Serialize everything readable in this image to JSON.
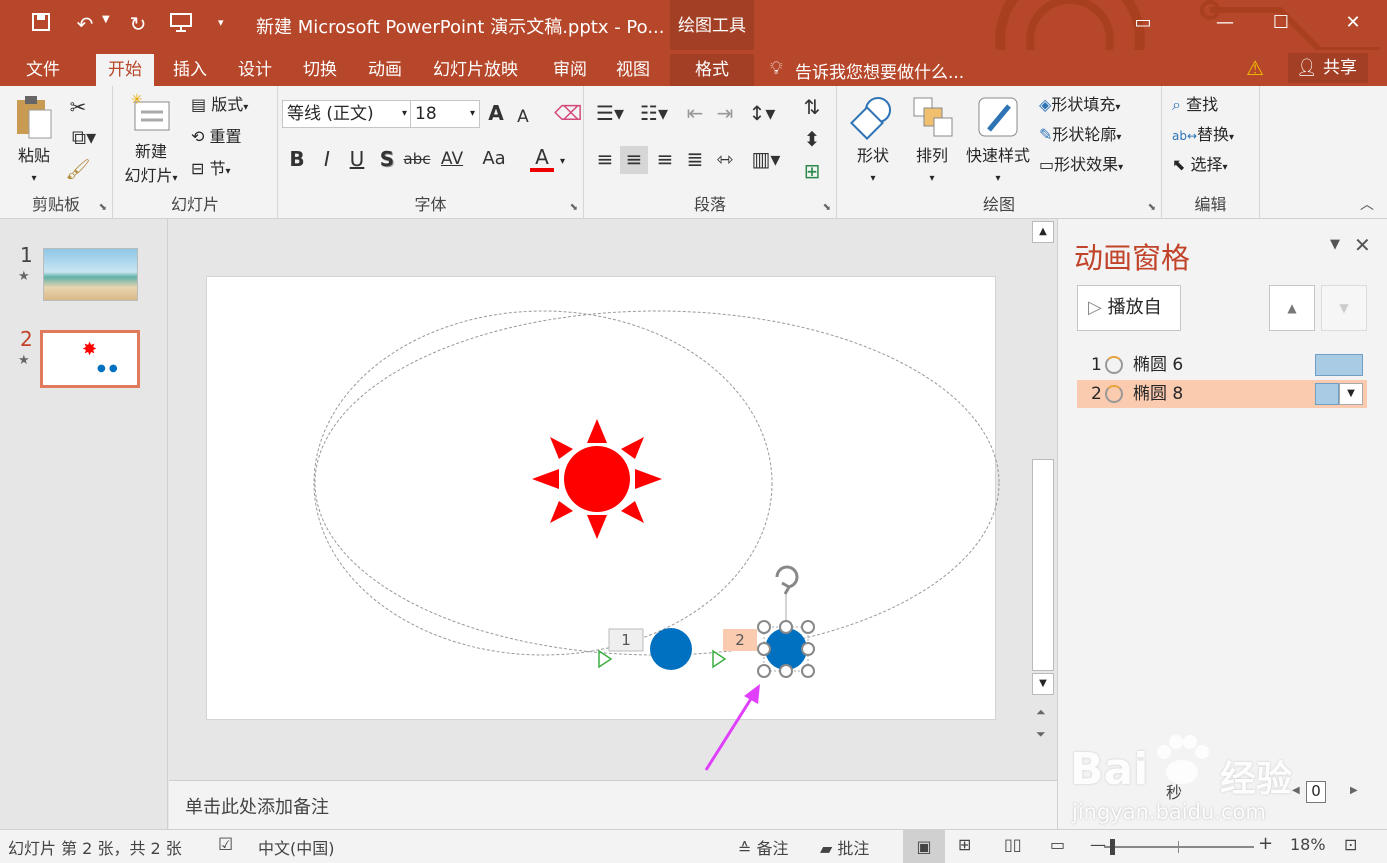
{
  "window": {
    "title": "新建 Microsoft PowerPoint 演示文稿.pptx - Po...",
    "context_tools": "绘图工具"
  },
  "tabs": [
    "文件",
    "开始",
    "插入",
    "设计",
    "切换",
    "动画",
    "幻灯片放映",
    "审阅",
    "视图",
    "格式"
  ],
  "tell_me": "告诉我您想要做什么...",
  "share": "共享",
  "ribbon": {
    "clipboard": {
      "paste": "粘贴",
      "label": "剪贴板"
    },
    "slides": {
      "new_slide_1": "新建",
      "new_slide_2": "幻灯片",
      "layout": "版式",
      "reset": "重置",
      "section": "节",
      "label": "幻灯片"
    },
    "font": {
      "font_name": "等线 (正文)",
      "font_size": "18",
      "label": "字体",
      "bold": "B",
      "italic": "I",
      "underline": "U",
      "shadow": "S",
      "strike": "abc",
      "spacing": "AV",
      "case": "Aa",
      "grow": "A",
      "shrink": "A",
      "color": "A"
    },
    "paragraph": {
      "label": "段落"
    },
    "drawing": {
      "shapes": "形状",
      "arrange": "排列",
      "quick_styles": "快速样式",
      "fill": "形状填充",
      "outline": "形状轮廓",
      "effects": "形状效果",
      "label": "绘图"
    },
    "editing": {
      "find": "查找",
      "replace": "替换",
      "select": "选择",
      "label": "编辑"
    }
  },
  "thumbs": [
    {
      "num": "1",
      "star": "★"
    },
    {
      "num": "2",
      "star": "★"
    }
  ],
  "slide": {
    "tag1": "1",
    "tag2": "2",
    "sun_color": "#ff0000",
    "planet_color": "#0070c0"
  },
  "notes_placeholder": "单击此处添加备注",
  "anim_pane": {
    "title": "动画窗格",
    "play_from": "播放自",
    "items": [
      {
        "num": "1",
        "name": "椭圆 6"
      },
      {
        "num": "2",
        "name": "椭圆 8"
      }
    ],
    "seconds_label": "秒",
    "zoom_value": "0"
  },
  "status": {
    "slide_info": "幻灯片 第 2 张，共 2 张",
    "language": "中文(中国)",
    "notes": "备注",
    "comments": "批注",
    "zoom": "18%"
  },
  "watermark": {
    "brand": "Bai",
    "brand2": "经验",
    "url": "jingyan.baidu.com"
  },
  "colors": {
    "accent": "#b7472a",
    "selected_item": "#fbcbb0",
    "highlight_blue": "#a9cbe3"
  }
}
